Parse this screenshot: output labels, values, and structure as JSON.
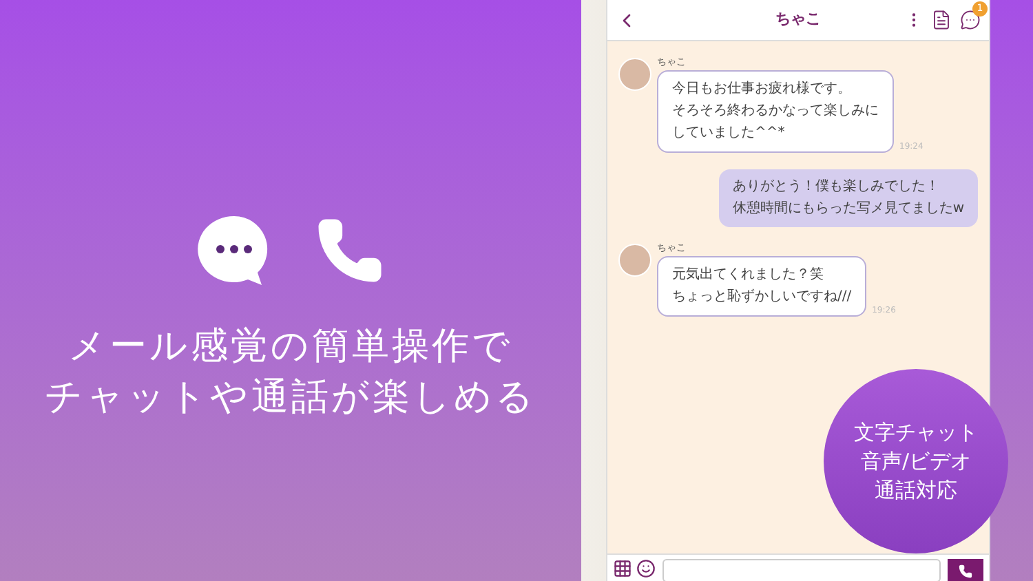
{
  "headline": [
    "メール感覚の簡単操作で",
    "チャットや通話が楽しめる"
  ],
  "phone": {
    "header": {
      "title": "ちゃこ",
      "badge": "1"
    },
    "messages": [
      {
        "kind": "incoming",
        "name": "ちゃこ",
        "lines": [
          "今日もお仕事お疲れ様です。",
          "そろそろ終わるかなって楽しみに",
          "していました^^*"
        ],
        "time": "19:24"
      },
      {
        "kind": "outgoing",
        "lines": [
          "ありがとう！僕も楽しみでした！",
          "休憩時間にもらった写メ見てましたw"
        ]
      },
      {
        "kind": "incoming",
        "name": "ちゃこ",
        "lines": [
          "元気出てくれました？笑",
          "ちょっと恥ずかしいですね///"
        ],
        "time": "19:26"
      }
    ]
  },
  "feature_badge": [
    "文字チャット",
    "音声/ビデオ",
    "通話対応"
  ]
}
